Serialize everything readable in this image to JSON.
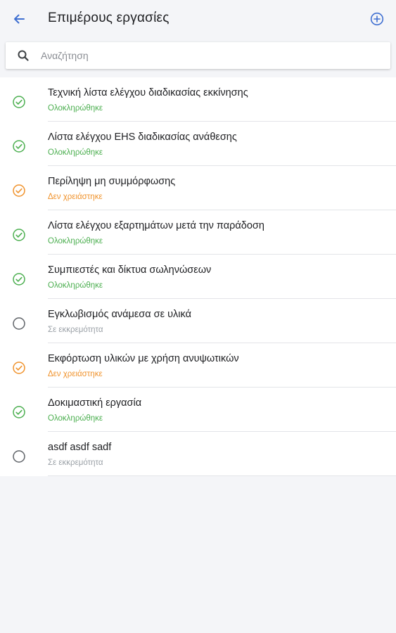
{
  "header": {
    "title": "Επιμέρους εργασίες",
    "back_icon": "arrow-left-icon",
    "add_icon": "plus-circle-icon"
  },
  "search": {
    "placeholder": "Αναζήτηση",
    "value": "",
    "icon": "search-icon"
  },
  "colors": {
    "accent": "#3f6fd1",
    "done": "#4caf50",
    "not_needed": "#f0922b",
    "pending": "#9aa0a6"
  },
  "tasks": [
    {
      "title": "Τεχνική λίστα ελέγχου διαδικασίας εκκίνησης",
      "status": "Ολοκληρώθηκε",
      "state": "done"
    },
    {
      "title": "Λίστα ελέγχου EHS διαδικασίας ανάθεσης",
      "status": "Ολοκληρώθηκε",
      "state": "done"
    },
    {
      "title": "Περίληψη μη συμμόρφωσης",
      "status": "Δεν χρειάστηκε",
      "state": "na"
    },
    {
      "title": "Λίστα ελέγχου εξαρτημάτων μετά την παράδοση",
      "status": "Ολοκληρώθηκε",
      "state": "done"
    },
    {
      "title": "Συμπιεστές και δίκτυα σωληνώσεων",
      "status": "Ολοκληρώθηκε",
      "state": "done"
    },
    {
      "title": "Εγκλωβισμός ανάμεσα σε υλικά",
      "status": "Σε εκκρεμότητα",
      "state": "pending"
    },
    {
      "title": "Εκφόρτωση υλικών με χρήση ανυψωτικών",
      "status": "Δεν χρειάστηκε",
      "state": "na"
    },
    {
      "title": "Δοκιμαστική εργασία",
      "status": "Ολοκληρώθηκε",
      "state": "done"
    },
    {
      "title": "asdf asdf sadf",
      "status": "Σε εκκρεμότητα",
      "state": "pending"
    }
  ]
}
